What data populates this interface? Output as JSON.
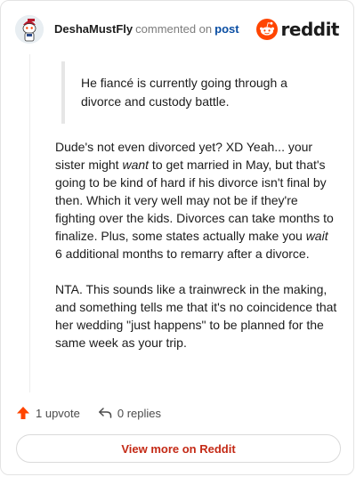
{
  "comment": {
    "author": "DeshaMustFly",
    "action_text": "commented on",
    "post_link": "post"
  },
  "brand": {
    "wordmark": "reddit",
    "color": "#ff4500"
  },
  "quote": {
    "text": "He fiancé is currently going through a divorce and custody battle."
  },
  "body": {
    "p1_a": "Dude's not even divorced yet? XD Yeah... your sister might ",
    "p1_em1": "want",
    "p1_b": " to get married in May, but that's going to be kind of hard if his divorce isn't final by then. Which it very well may not be if they're fighting over the kids. Divorces can take months to finalize. Plus, some states actually make you ",
    "p1_em2": "wait",
    "p1_c": " 6 additional months to remarry after a divorce.",
    "p2": "NTA. This sounds like a trainwreck in the making, and something tells me that it's no coincidence that her wedding \"just happens\" to be planned for the same week as your trip."
  },
  "actions": {
    "upvote_label": "1 upvote",
    "replies_label": "0 replies",
    "upvote_icon": "upvote-arrow-icon",
    "reply_icon": "reply-arrow-icon"
  },
  "footer": {
    "view_more_label": "View more on Reddit"
  },
  "colors": {
    "upvote": "#ff4500",
    "link": "#0a4ea3",
    "view_more": "#c42a16"
  }
}
